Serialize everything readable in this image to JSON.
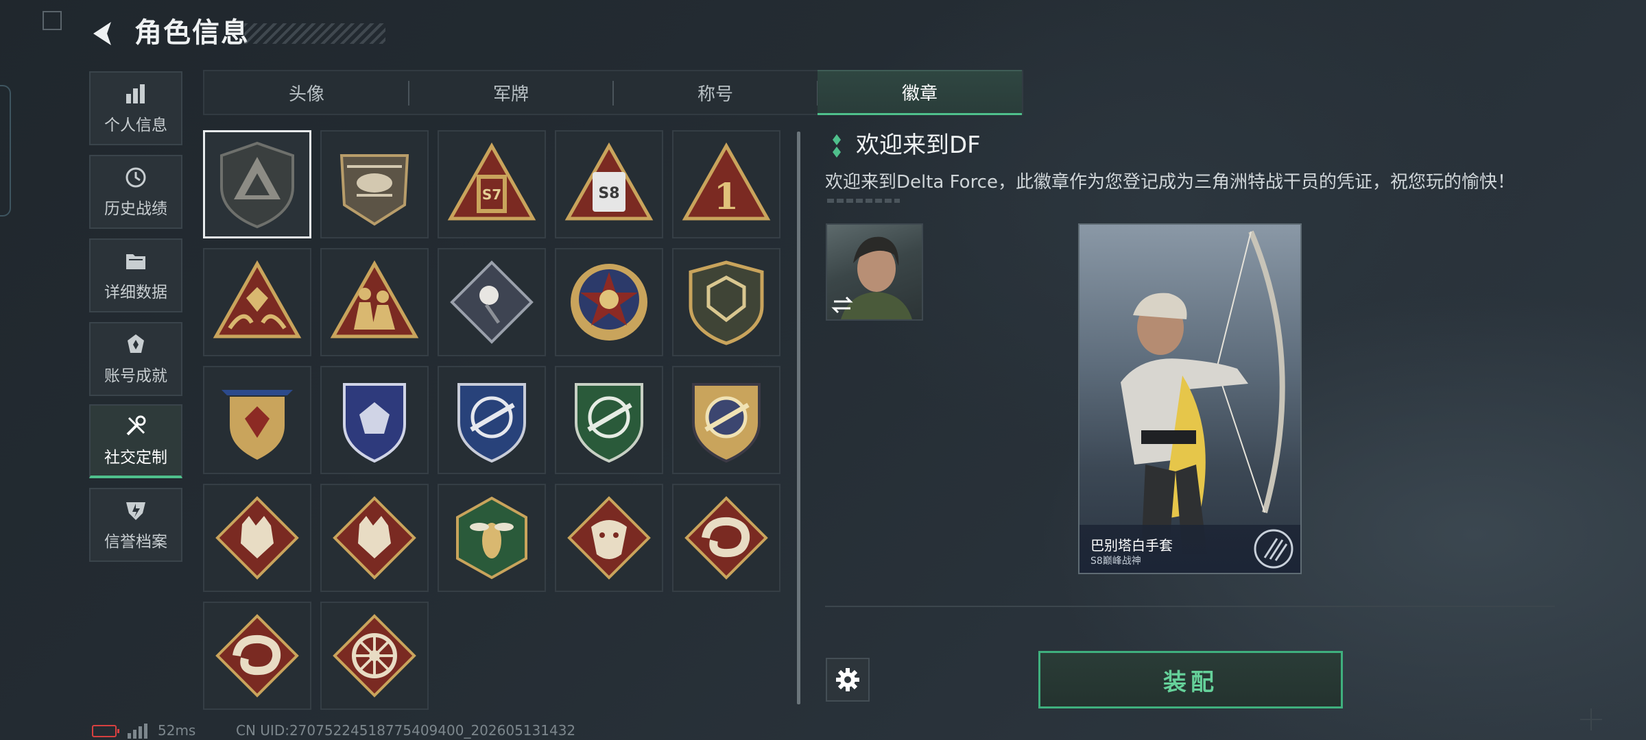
{
  "header": {
    "title": "角色信息"
  },
  "sidebar": {
    "items": [
      {
        "label": "个人信息",
        "icon": "bar-chart-icon"
      },
      {
        "label": "历史战绩",
        "icon": "history-icon"
      },
      {
        "label": "详细数据",
        "icon": "folder-icon"
      },
      {
        "label": "账号成就",
        "icon": "achievement-icon"
      },
      {
        "label": "社交定制",
        "icon": "tools-icon",
        "active": true
      },
      {
        "label": "信誉档案",
        "icon": "credit-shield-icon"
      }
    ]
  },
  "tabs": [
    {
      "label": "头像"
    },
    {
      "label": "军牌"
    },
    {
      "label": "称号"
    },
    {
      "label": "徽章",
      "active": true
    }
  ],
  "badges": {
    "selected_index": 0,
    "items": [
      {
        "icon": "delta-shield-badge-icon",
        "text": ""
      },
      {
        "icon": "helicopter-badge-icon",
        "text": ""
      },
      {
        "icon": "season-7-badge-icon",
        "text": "S7"
      },
      {
        "icon": "season-8-badge-icon",
        "text": "S8"
      },
      {
        "icon": "rank-one-badge-icon",
        "text": "1"
      },
      {
        "icon": "hands-gem-badge-icon",
        "text": ""
      },
      {
        "icon": "soldiers-badge-icon",
        "text": ""
      },
      {
        "icon": "rose-badge-icon",
        "text": ""
      },
      {
        "icon": "star-compass-badge-icon",
        "text": ""
      },
      {
        "icon": "shield-emblem-badge-icon",
        "text": ""
      },
      {
        "icon": "gold-shield-stars-badge-icon",
        "text": ""
      },
      {
        "icon": "blue-shield-stars-badge-icon",
        "text": ""
      },
      {
        "icon": "blue-rifle-crosshair-badge-icon",
        "text": ""
      },
      {
        "icon": "green-rifle-crosshair-badge-icon",
        "text": ""
      },
      {
        "icon": "gold-rifle-crosshair-badge-icon",
        "text": ""
      },
      {
        "icon": "wolf-badge-icon",
        "text": ""
      },
      {
        "icon": "wolf-badge-icon",
        "text": ""
      },
      {
        "icon": "wasp-badge-icon",
        "text": ""
      },
      {
        "icon": "dragon-badge-icon",
        "text": ""
      },
      {
        "icon": "serpent-badge-icon",
        "text": ""
      },
      {
        "icon": "serpent-badge-icon",
        "text": ""
      },
      {
        "icon": "dharma-wheel-badge-icon",
        "text": ""
      }
    ]
  },
  "detail": {
    "title": "欢迎来到DF",
    "description": "欢迎来到Delta Force，此徽章作为您登记成为三角洲特战干员的凭证，祝您玩的愉快！",
    "card": {
      "name": "巴别塔白手套",
      "subtitle": "S8巅峰战神"
    },
    "equip_label": "装配"
  },
  "status": {
    "ping": "52ms",
    "uid": "CN UID:27075224518775409400_202605131432"
  },
  "colors": {
    "accent": "#4fc08c",
    "background": "#242c33",
    "badge_gold": "#c9a45c",
    "badge_red": "#7a2a22"
  }
}
